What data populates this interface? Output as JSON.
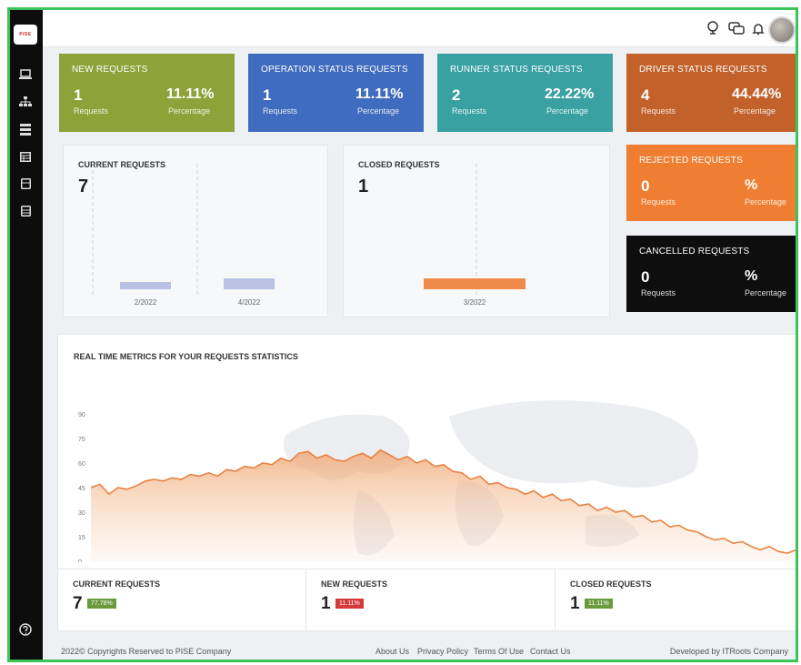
{
  "logo": {
    "text": "PISE"
  },
  "sidebar": {
    "items": [
      {
        "icon": "laptop-icon"
      },
      {
        "icon": "sitemap-icon"
      },
      {
        "icon": "server-icon"
      },
      {
        "icon": "table-icon"
      },
      {
        "icon": "document-icon"
      },
      {
        "icon": "document-alt-icon"
      }
    ],
    "help_icon": "help-circle-icon"
  },
  "topbar": {
    "icons": [
      "globe-icon",
      "chat-icon",
      "bell-icon",
      "avatar"
    ]
  },
  "cards": {
    "new": {
      "title": "NEW REQUESTS",
      "count": "1",
      "count_label": "Requests",
      "percent": "11.11%",
      "percent_label": "Percentage",
      "color": "#8fa23a"
    },
    "operation": {
      "title": "OPERATION STATUS REQUESTS",
      "count": "1",
      "count_label": "Requests",
      "percent": "11.11%",
      "percent_label": "Percentage",
      "color": "#3f6cbf"
    },
    "runner": {
      "title": "RUNNER STATUS REQUESTS",
      "count": "2",
      "count_label": "Requests",
      "percent": "22.22%",
      "percent_label": "Percentage",
      "color": "#3aa1a3"
    },
    "driver": {
      "title": "DRIVER STATUS REQUESTS",
      "count": "4",
      "count_label": "Requests",
      "percent": "44.44%",
      "percent_label": "Percentage",
      "color": "#c2612a"
    },
    "rejected": {
      "title": "REJECTED REQUESTS",
      "count": "0",
      "count_label": "Requests",
      "percent": "%",
      "percent_label": "Percentage",
      "color": "#ef7e32"
    },
    "cancelled": {
      "title": "CANCELLED REQUESTS",
      "count": "0",
      "count_label": "Requests",
      "percent": "%",
      "percent_label": "Percentage",
      "color": "#0e0e0e"
    }
  },
  "current_requests": {
    "title": "CURRENT REQUESTS",
    "value": "7",
    "bars": [
      {
        "label": "2/2022",
        "value": 1
      },
      {
        "label": "4/2022",
        "value": 2
      }
    ],
    "bar_color": "#b9c2e3"
  },
  "closed_requests": {
    "title": "CLOSED REQUESTS",
    "value": "1",
    "bars": [
      {
        "label": "3/2022",
        "value": 1
      }
    ],
    "bar_color": "#f08a4b"
  },
  "metrics": {
    "title": "REAL TIME METRICS FOR YOUR REQUESTS STATISTICS",
    "y_ticks": [
      "90",
      "75",
      "60",
      "45",
      "30",
      "15",
      "0"
    ],
    "line_color": "#e8823f",
    "bottom": [
      {
        "title": "CURRENT REQUESTS",
        "value": "7",
        "badge": "77.78%",
        "badge_color": "#6a9b3b"
      },
      {
        "title": "NEW REQUESTS",
        "value": "1",
        "badge": "11.11%",
        "badge_color": "#d43a3a"
      },
      {
        "title": "CLOSED REQUESTS",
        "value": "1",
        "badge": "11.11%",
        "badge_color": "#6a9b3b"
      }
    ]
  },
  "chart_data": {
    "type": "area",
    "title": "REAL TIME METRICS FOR YOUR REQUESTS STATISTICS",
    "ylim": [
      0,
      90
    ],
    "y_ticks": [
      0,
      15,
      30,
      45,
      60,
      75,
      90
    ],
    "values": [
      45,
      47,
      41,
      45,
      44,
      46,
      49,
      50,
      49,
      51,
      50,
      53,
      52,
      54,
      52,
      56,
      55,
      58,
      57,
      60,
      59,
      63,
      61,
      66,
      67,
      63,
      65,
      62,
      61,
      64,
      66,
      63,
      68,
      65,
      62,
      64,
      60,
      62,
      58,
      59,
      55,
      54,
      50,
      52,
      47,
      48,
      45,
      44,
      41,
      43,
      39,
      41,
      37,
      38,
      34,
      35,
      31,
      33,
      30,
      31,
      27,
      28,
      24,
      25,
      21,
      22,
      19,
      18,
      15,
      13,
      14,
      11,
      12,
      9,
      7,
      9,
      6,
      5,
      7
    ]
  },
  "footer": {
    "copyright": "2022© Copyrights Reserved to PISE Company",
    "links": [
      "About Us",
      "Privacy Policy",
      "Terms Of Use",
      "Contact Us"
    ],
    "developer": "Developed by ITRoots Company"
  }
}
